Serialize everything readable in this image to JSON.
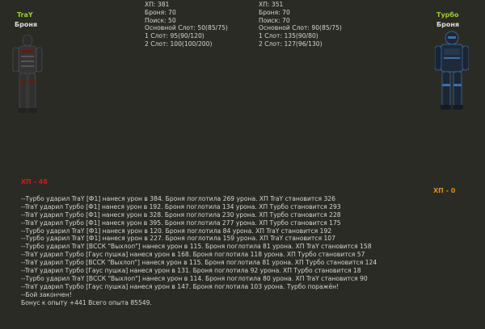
{
  "left_fighter": {
    "name": "TraY",
    "armor_label": "Броня",
    "hp_label": "ХП - 46",
    "colors": {
      "body": "#3a3a3a",
      "accent": "#7a1010"
    }
  },
  "right_fighter": {
    "name": "Турбо",
    "armor_label": "Броня",
    "hp_label": "ХП - 0",
    "colors": {
      "body": "#1e2a3a",
      "accent": "#3d6fa8"
    }
  },
  "left_stats": [
    "ХП: 381",
    "Броня: 70",
    "Поиск: 50",
    "Основной Слот: 50(85/75)",
    "1 Слот: 95(90/120)",
    "2 Слот: 100(100/200)"
  ],
  "right_stats": [
    "ХП: 351",
    "Броня: 70",
    "Поиск: 70",
    "Основной Слот: 90(85/75)",
    "1 Слот: 135(90/80)",
    "2 Слот: 127(96/130)"
  ],
  "battle_log": [
    "--Турбо ударил TraY [Ф1] нанеся урон в 384. Броня поглотила 269 урона. ХП TraY становится 326",
    "--TraY ударил Турбо [Ф1] нанеся урон в 192. Броня поглотила 134 урона. ХП Турбо становится 293",
    "--TraY ударил Турбо [Ф1] нанеся урон в 328. Броня поглотила 230 урона. ХП Турбо становится 228",
    "--TraY ударил Турбо [Ф1] нанеся урон в 395. Броня поглотила 277 урона. ХП Турбо становится 175",
    "--Турбо ударил TraY [Ф1] нанеся урон в 120. Броня поглотила 84 урона. ХП TraY становится 192",
    "--Турбо ударил TraY [Ф1] нанеся урон в 227. Броня поглотила 159 урона. ХП TraY становится 107",
    "--Турбо ударил TraY [ВССК \"Выхлоп\"] нанеся урон в 115. Броня поглотила 81 урона. ХП TraY становится 158",
    "--TraY ударил Турбо [Гаус пушка] нанеся урон в 168. Броня поглотила 118 урона. ХП Турбо становится 57",
    "--TraY ударил Турбо [ВССК \"Выхлоп\"] нанеся урон в 115. Броня поглотила 81 урона. ХП Турбо становится 124",
    "--TraY ударил Турбо [Гаус пушка] нанеся урон в 131. Броня поглотила 92 урона. ХП Турбо становится 18",
    "--Турбо ударил TraY [ВССК \"Выхлоп\"] нанеся урон в 114. Броня поглотила 80 урона. ХП TraY становится 90",
    "--TraY ударил Турбо [Гаус пушка] нанеся урон в 147. Броня поглотила 103 урона. Турбо поражён!",
    "--Бой закончен!",
    "Бонус к опыту +441 Всего опыта 85549."
  ]
}
